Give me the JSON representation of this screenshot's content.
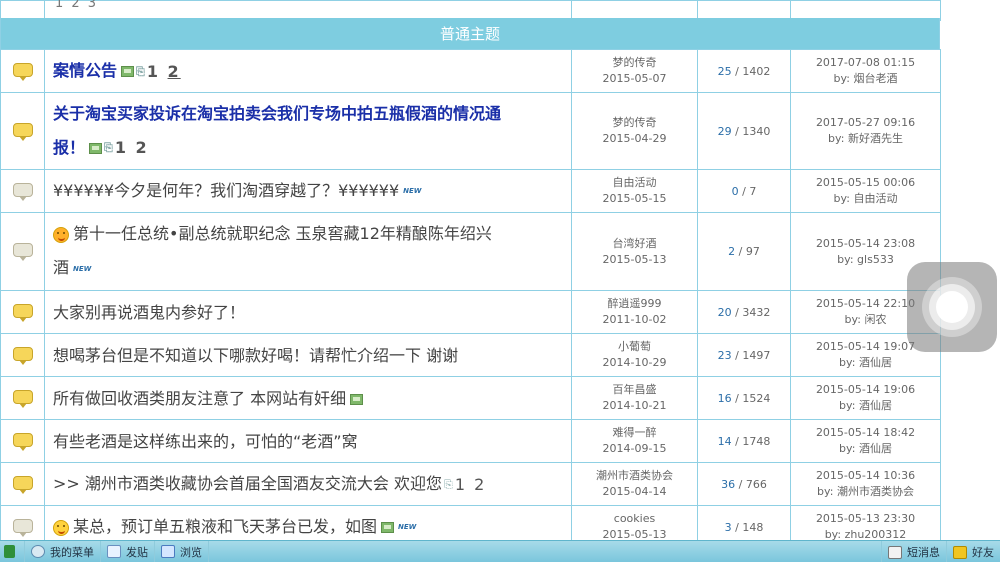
{
  "top_partial_pages": "1 2 3",
  "section_header": "普通主题",
  "topics": [
    {
      "icon": "folder-icon-hot",
      "title": "案情公告",
      "bold": true,
      "has_image": true,
      "has_attachment": true,
      "pages": [
        "1",
        "2"
      ],
      "is_new": false,
      "smiley": null,
      "author": "梦的传奇",
      "date": "2015-05-07",
      "replies": "25",
      "views": "1402",
      "last_time": "2017-07-08 01:15",
      "last_by": "by: 烟台老酒"
    },
    {
      "icon": "folder-icon-hot",
      "title_line1": "关于淘宝买家投诉在淘宝拍卖会我们专场中拍五瓶假酒的情况通",
      "title_line2": "报！",
      "bold": true,
      "has_image": true,
      "has_attachment": true,
      "pages": [
        "1",
        "2"
      ],
      "author": "梦的传奇",
      "date": "2015-04-29",
      "replies": "29",
      "views": "1340",
      "last_time": "2017-05-27 09:16",
      "last_by": "by: 新好酒先生"
    },
    {
      "icon": "folder-icon-normal",
      "title": "¥¥¥¥¥¥今夕是何年？我们淘酒穿越了？¥¥¥¥¥¥",
      "is_new": true,
      "author": "自由活动",
      "date": "2015-05-15",
      "replies": "0",
      "views": "7",
      "last_time": "2015-05-15 00:06",
      "last_by": "by: 自由活动"
    },
    {
      "icon": "folder-icon-normal",
      "title_line1": "第十一任总统•副总统就职纪念 玉泉窖藏12年精酿陈年绍兴",
      "title_line2": "酒",
      "smiley": "angry",
      "is_new": true,
      "author": "台湾好酒",
      "date": "2015-05-13",
      "replies": "2",
      "views": "97",
      "last_time": "2015-05-14 23:08",
      "last_by": "by: gls533"
    },
    {
      "icon": "folder-icon-hot",
      "title": "大家别再说酒鬼内参好了！",
      "author": "醉逍遥999",
      "date": "2011-10-02",
      "replies": "20",
      "views": "3432",
      "last_time": "2015-05-14 22:10",
      "last_by": "by: 闲农"
    },
    {
      "icon": "folder-icon-hot",
      "title": "想喝茅台但是不知道以下哪款好喝！请帮忙介绍一下 谢谢",
      "author": "小葡萄",
      "date": "2014-10-29",
      "replies": "23",
      "views": "1497",
      "last_time": "2015-05-14 19:07",
      "last_by": "by: 酒仙居"
    },
    {
      "icon": "folder-icon-hot",
      "title": "所有做回收酒类朋友注意了 本网站有奸细",
      "has_image": true,
      "author": "百年昌盛",
      "date": "2014-10-21",
      "replies": "16",
      "views": "1524",
      "last_time": "2015-05-14 19:06",
      "last_by": "by: 酒仙居"
    },
    {
      "icon": "folder-icon-hot",
      "title": "有些老酒是这样练出来的，可怕的“老酒”窝",
      "author": "难得一醉",
      "date": "2014-09-15",
      "replies": "14",
      "views": "1748",
      "last_time": "2015-05-14 18:42",
      "last_by": "by: 酒仙居"
    },
    {
      "icon": "folder-icon-hot",
      "title": ">> 潮州市酒类收藏协会首届全国酒友交流大会 欢迎您",
      "has_attachment": true,
      "pages": [
        "1",
        "2"
      ],
      "author": "潮州市酒类协会",
      "date": "2015-04-14",
      "replies": "36",
      "views": "766",
      "last_time": "2015-05-14 10:36",
      "last_by": "by: 潮州市酒类协会"
    },
    {
      "icon": "folder-icon-normal",
      "title": "某总，预订单五粮液和飞天茅台已发，如图",
      "smiley": "happy",
      "has_image": true,
      "is_new": true,
      "author": "cookies",
      "date": "2015-05-13",
      "replies": "3",
      "views": "148",
      "last_time": "2015-05-13 23:30",
      "last_by": "by: zhu200312"
    }
  ],
  "new_tag": "NEW",
  "stats_separator": " / ",
  "bottombar": {
    "my_menu": "我的菜单",
    "post": "发贴",
    "browse": "浏览",
    "messages": "短消息",
    "friends": "好友"
  }
}
